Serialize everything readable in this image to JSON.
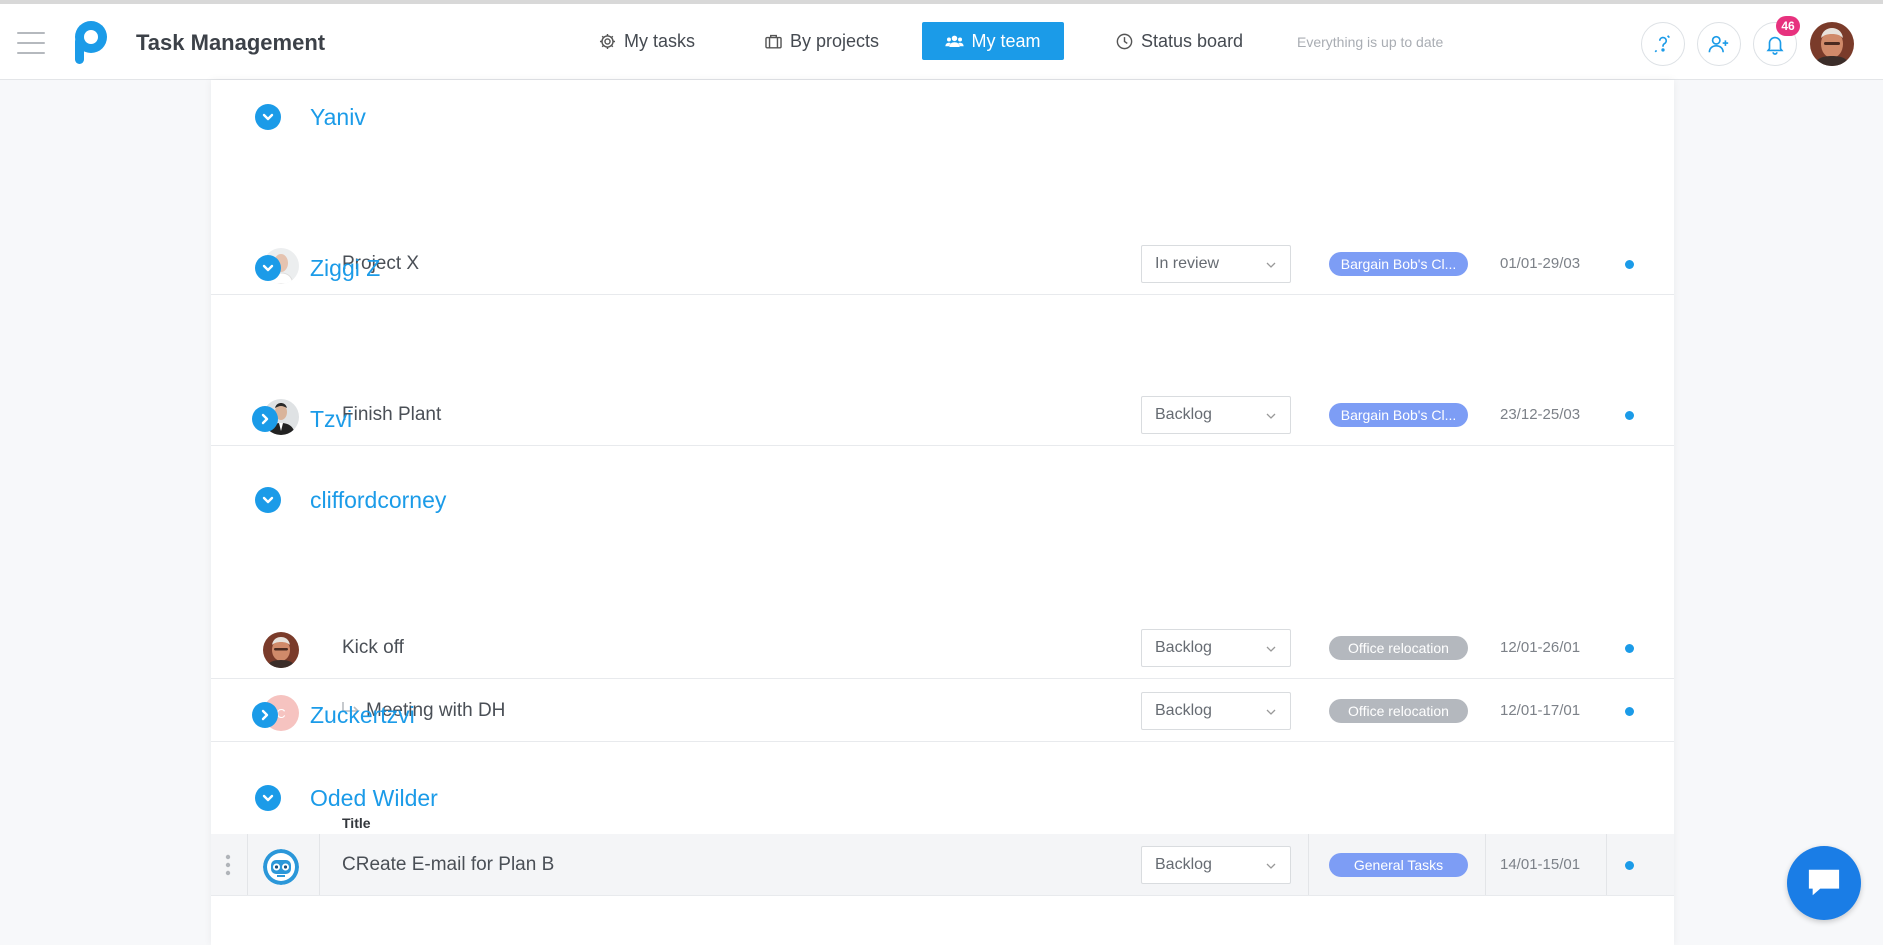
{
  "header": {
    "app_title": "Task Management",
    "tabs": [
      {
        "label": "My tasks",
        "icon": "gear-icon",
        "active": false
      },
      {
        "label": "By projects",
        "icon": "briefcase-icon",
        "active": false
      },
      {
        "label": "My team",
        "icon": "team-icon",
        "active": true
      },
      {
        "label": "Status board",
        "icon": "clock-icon",
        "active": false
      }
    ],
    "sync_status": "Everything is up to date",
    "notifications_count": "46"
  },
  "colors": {
    "accent": "#1b9be8",
    "badge_blue": "#7d9df5",
    "badge_gray": "#b4b8be",
    "notification": "#e7327e"
  },
  "groups": [
    {
      "name": "Yaniv",
      "expanded": true,
      "tasks": [
        {
          "name": "Project X",
          "status": "In review",
          "project": "Bargain Bob's Cl...",
          "project_color": "#7d9df5",
          "dates": "01/01-29/03",
          "avatar": "bald-man-avatar",
          "subtask": false
        }
      ]
    },
    {
      "name": "Ziggi Z",
      "expanded": true,
      "tasks": [
        {
          "name": "Finish Plant",
          "status": "Backlog",
          "project": "Bargain Bob's Cl...",
          "project_color": "#7d9df5",
          "dates": "23/12-25/03",
          "avatar": "suited-man-avatar",
          "subtask": false
        }
      ]
    },
    {
      "name": "Tzvi",
      "expanded": false,
      "tasks": []
    },
    {
      "name": "cliffordcorney",
      "expanded": true,
      "tasks": [
        {
          "name": "Kick off",
          "status": "Backlog",
          "project": "Office relocation",
          "project_color": "#b4b8be",
          "dates": "12/01-26/01",
          "avatar": "clifford-avatar",
          "subtask": false
        },
        {
          "name": "Meeting with DH",
          "status": "Backlog",
          "project": "Office relocation",
          "project_color": "#b4b8be",
          "dates": "12/01-17/01",
          "avatar": "letter-avatar",
          "avatar_letter": "C",
          "subtask": true
        }
      ]
    },
    {
      "name": "Zuckertzvi",
      "expanded": false,
      "tasks": []
    },
    {
      "name": "Oded Wilder",
      "expanded": true,
      "column_title": "Title",
      "tasks": [
        {
          "name": "CReate E-mail for Plan B",
          "status": "Backlog",
          "project": "General Tasks",
          "project_color": "#7d9df5",
          "dates": "14/01-15/01",
          "avatar": "robot-avatar",
          "subtask": false
        }
      ]
    }
  ]
}
